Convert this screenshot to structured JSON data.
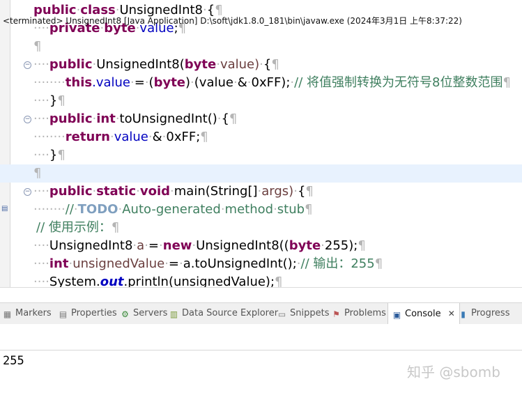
{
  "editor": {
    "line1": {
      "kw1": "public",
      "kw2": "class",
      "name": "UnsignedInt8",
      "brace": "{"
    },
    "line2": {
      "kw1": "private",
      "kw2": "byte",
      "field": "value",
      ";": ";"
    },
    "line4": {
      "kw1": "public",
      "ctor": "UnsignedInt8(",
      "kw2": "byte",
      "param": "value)",
      "brace": "{"
    },
    "line5": {
      "kw": "this",
      "dotfield": ".value",
      "rest1": "=",
      "paren": "(",
      "kw2": "byte",
      "rest2": ")",
      "rest3": "(value",
      "amp": "&",
      "hex": "0xFF);",
      "comment": "// 将值强制转换为无符号8位整数范围"
    },
    "line6": {
      "brace": "}"
    },
    "line7": {
      "kw1": "public",
      "kw2": "int",
      "method": "toUnsignedInt()",
      "brace": "{"
    },
    "line8": {
      "kw": "return",
      "field": "value",
      "amp": "&",
      "hex": "0xFF;"
    },
    "line9": {
      "brace": "}"
    },
    "line11": {
      "kw1": "public",
      "kw2": "static",
      "kw3": "void",
      "method": "main(String[]",
      "param": "args)",
      "brace": "{"
    },
    "line12": {
      "c1": "//",
      "todo": "TODO",
      "c2": "Auto-generated",
      "c3": "method",
      "c4": "stub"
    },
    "line13": {
      "comment": "// 使用示例："
    },
    "line14": {
      "type": "UnsignedInt8",
      "var": "a",
      "eq": "=",
      "kw": "new",
      "call": "UnsignedInt8((",
      "kw2": "byte",
      "arg": "255);"
    },
    "line15": {
      "kw": "int",
      "var": "unsignedValue",
      "eq": "=",
      "call": "a.toUnsignedInt();",
      "comment": "// 输出：255"
    },
    "line16": {
      "pre": "System.",
      "stat": "out",
      "post": ".println(unsignedValue);"
    },
    "pilcrow": "¶"
  },
  "tabs": [
    {
      "label": "Markers",
      "icon": "markers-icon"
    },
    {
      "label": "Properties",
      "icon": "properties-icon"
    },
    {
      "label": "Servers",
      "icon": "servers-icon"
    },
    {
      "label": "Data Source Explorer",
      "icon": "data-source-icon"
    },
    {
      "label": "Snippets",
      "icon": "snippets-icon"
    },
    {
      "label": "Problems",
      "icon": "problems-icon"
    },
    {
      "label": "Console",
      "icon": "console-icon",
      "active": true,
      "close": "✕"
    },
    {
      "label": "Progress",
      "icon": "progress-icon"
    }
  ],
  "console": {
    "terminated": "<terminated> UnsignedInt8 [Java Application] D:\\soft\\jdk1.8.0_181\\bin\\javaw.exe (2024年3月1日 上午8:37:22)",
    "output": "255"
  },
  "watermark": "知乎 @sbomb"
}
